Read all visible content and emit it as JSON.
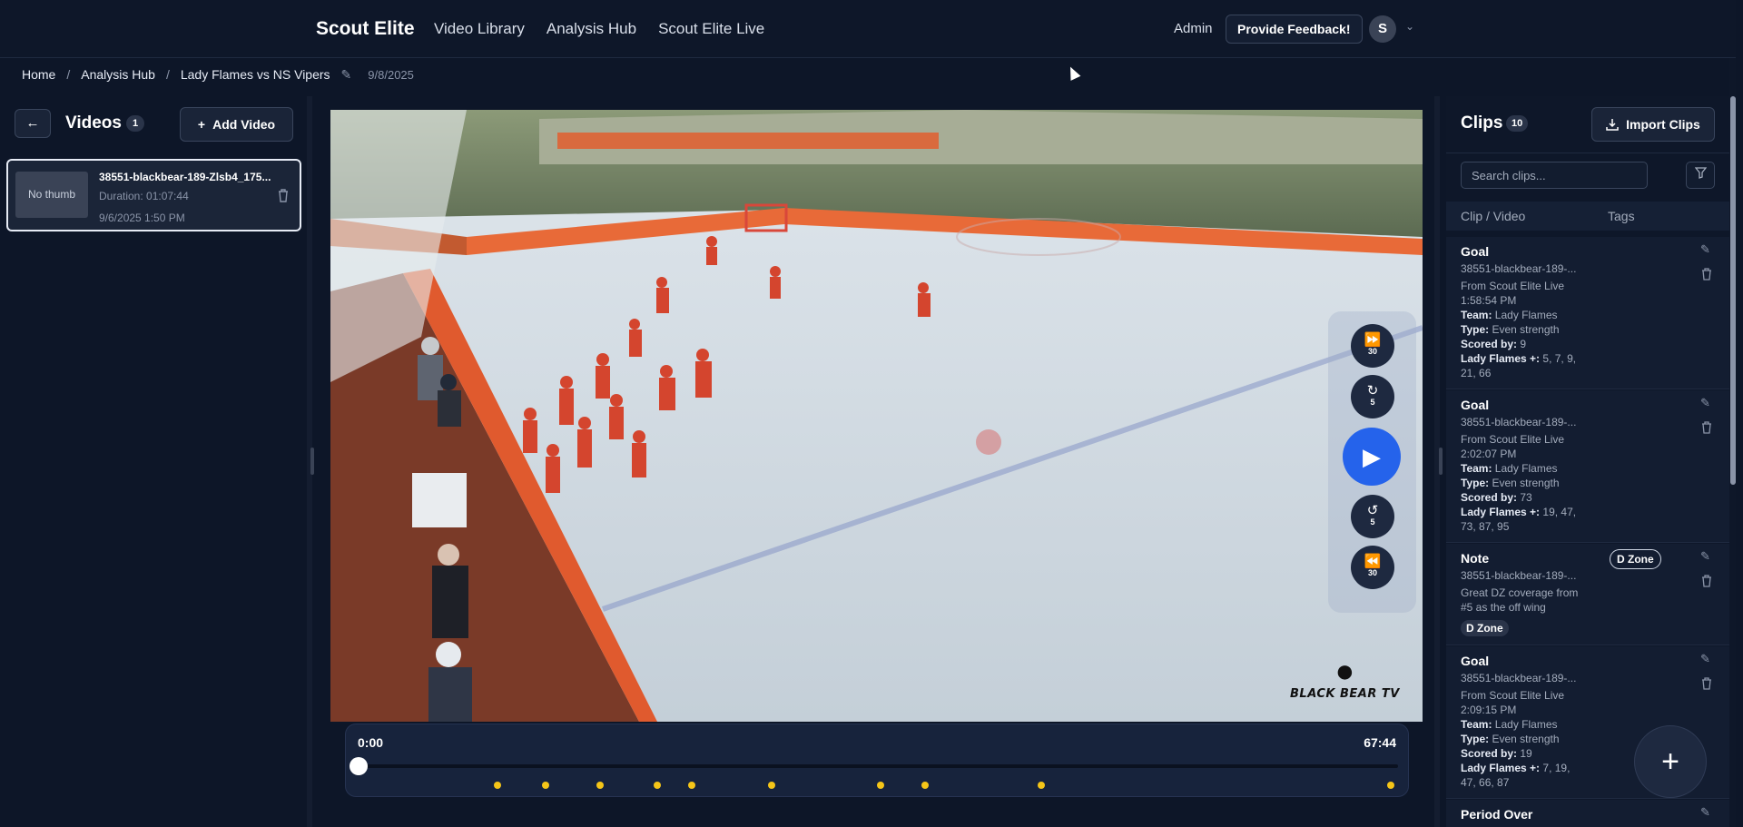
{
  "nav": {
    "brand": "Scout Elite",
    "links": [
      "Video Library",
      "Analysis Hub",
      "Scout Elite Live"
    ],
    "admin": "Admin",
    "feedback": "Provide Feedback!",
    "avatar_initial": "S"
  },
  "breadcrumb": {
    "home": "Home",
    "hub": "Analysis Hub",
    "game": "Lady Flames vs NS Vipers",
    "date": "9/8/2025"
  },
  "videos": {
    "back": "←",
    "title": "Videos",
    "count": "1",
    "add_label": "Add Video",
    "items": [
      {
        "thumb": "No thumb",
        "title": "38551-blackbear-189-Zlsb4_175...",
        "duration": "Duration: 01:07:44",
        "date": "9/6/2025 1:50 PM"
      }
    ]
  },
  "player": {
    "watermark": "BLACK BEAR TV",
    "controls": {
      "ff30": "30",
      "fwd5": "5",
      "back5": "5",
      "rw30": "30"
    },
    "time_start": "0:00",
    "time_end": "67:44",
    "progress": 0,
    "marker_fractions": [
      0.134,
      0.181,
      0.233,
      0.288,
      0.321,
      0.398,
      0.503,
      0.545,
      0.657,
      0.993
    ],
    "marker_color": "#f5c518"
  },
  "clips": {
    "title": "Clips",
    "count": "10",
    "import_label": "Import Clips",
    "search_placeholder": "Search clips...",
    "col_video": "Clip / Video",
    "col_tags": "Tags",
    "items": [
      {
        "title": "Goal",
        "src": "38551-blackbear-189-...",
        "from": "From Scout Elite Live",
        "time": "1:58:54 PM",
        "team_k": "Team:",
        "team_v": "Lady Flames",
        "type_k": "Type:",
        "type_v": "Even strength",
        "scored_k": "Scored by:",
        "scored_v": "9",
        "plus_k": "Lady Flames +:",
        "plus_v": "5, 7, 9, 21, 66"
      },
      {
        "title": "Goal",
        "src": "38551-blackbear-189-...",
        "from": "From Scout Elite Live",
        "time": "2:02:07 PM",
        "team_k": "Team:",
        "team_v": "Lady Flames",
        "type_k": "Type:",
        "type_v": "Even strength",
        "scored_k": "Scored by:",
        "scored_v": "73",
        "plus_k": "Lady Flames +:",
        "plus_v": "19, 47, 73, 87, 95"
      },
      {
        "title": "Note",
        "src": "38551-blackbear-189-...",
        "note": "Great DZ coverage from #5 as the off wing",
        "tag": "D Zone"
      },
      {
        "title": "Goal",
        "src": "38551-blackbear-189-...",
        "from": "From Scout Elite Live",
        "time": "2:09:15 PM",
        "team_k": "Team:",
        "team_v": "Lady Flames",
        "type_k": "Type:",
        "type_v": "Even strength",
        "scored_k": "Scored by:",
        "scored_v": "19",
        "plus_k": "Lady Flames +:",
        "plus_v": "7, 19, 47, 66, 87"
      },
      {
        "title": "Period Over"
      }
    ]
  },
  "icons": {
    "edit": "pencil-icon",
    "trash": "trash-icon",
    "filter": "filter-icon",
    "upload": "upload-icon",
    "plus": "plus-icon"
  }
}
